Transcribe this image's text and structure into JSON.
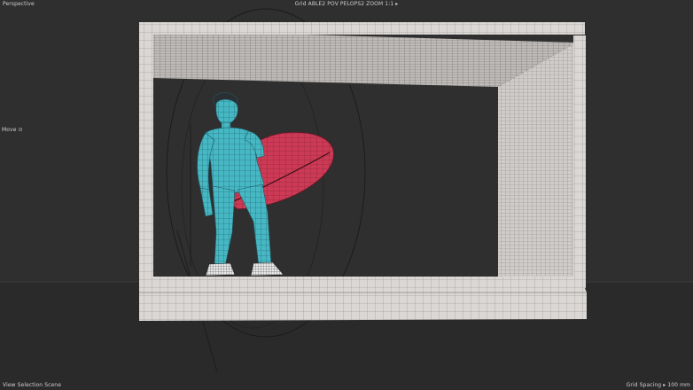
{
  "viewport": {
    "view_label": "Perspective",
    "stats": "Grid ABLE2  POV  PELOPS2    ZOOM 1:1 ▸",
    "side_label": "Move ⊙",
    "scene_label": "View Selection Scene",
    "grid_label": "Grid Spacing ▸ 100 mm"
  },
  "scene": {
    "character_color": "#46b8c4",
    "surfboard_color": "#cc3a55",
    "box_color": "#d9d6d3",
    "background_color": "#2f2f2f",
    "floor_color": "#2a2a2a"
  }
}
